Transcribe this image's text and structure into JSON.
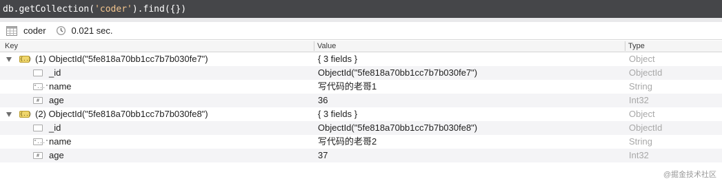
{
  "query": {
    "prefix": "db.getCollection(",
    "argument": "'coder'",
    "suffix": ").find({})"
  },
  "info": {
    "collection": "coder",
    "elapsed": "0.021 sec."
  },
  "columns": {
    "key": "Key",
    "value": "Value",
    "type": "Type"
  },
  "documents": [
    {
      "key": "(1) ObjectId(\"5fe818a70bb1cc7b7b030fe7\")",
      "value": "{ 3 fields }",
      "type": "Object",
      "fields": [
        {
          "key": "_id",
          "value": "ObjectId(\"5fe818a70bb1cc7b7b030fe7\")",
          "type": "ObjectId",
          "icon": "id-field-icon"
        },
        {
          "key": "name",
          "value": "写代码的老哥1",
          "type": "String",
          "icon": "string-field-icon"
        },
        {
          "key": "age",
          "value": "36",
          "type": "Int32",
          "icon": "number-field-icon"
        }
      ]
    },
    {
      "key": "(2) ObjectId(\"5fe818a70bb1cc7b7b030fe8\")",
      "value": "{ 3 fields }",
      "type": "Object",
      "fields": [
        {
          "key": "_id",
          "value": "ObjectId(\"5fe818a70bb1cc7b7b030fe8\")",
          "type": "ObjectId",
          "icon": "id-field-icon"
        },
        {
          "key": "name",
          "value": "写代码的老哥2",
          "type": "String",
          "icon": "string-field-icon"
        },
        {
          "key": "age",
          "value": "37",
          "type": "Int32",
          "icon": "number-field-icon"
        }
      ]
    }
  ],
  "watermark": "@掘金技术社区"
}
